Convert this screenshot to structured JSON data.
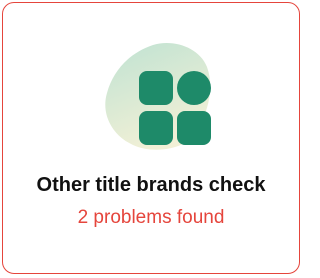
{
  "card": {
    "title": "Other title brands check",
    "status": "2 problems found",
    "status_color": "#e5453c",
    "icon": "app-grid-icon",
    "icon_color": "#1e8a69"
  }
}
